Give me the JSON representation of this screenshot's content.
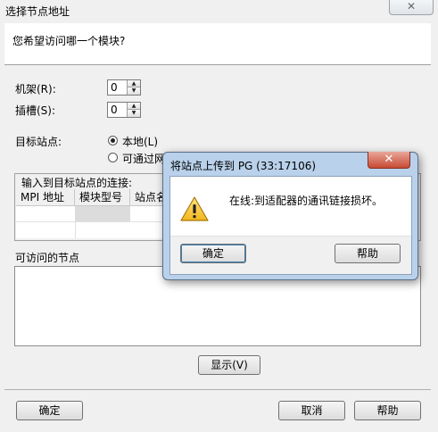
{
  "window": {
    "title": "选择节点地址",
    "close_glyph": "✕"
  },
  "header": {
    "question": "您希望访问哪一个模块?"
  },
  "rack": {
    "label": "机架(R):",
    "value": "0"
  },
  "slot": {
    "label": "插槽(S):",
    "value": "0"
  },
  "target": {
    "label": "目标站点:",
    "options": [
      "本地(L)",
      "可通过网"
    ],
    "selected": "本地(L)"
  },
  "connection": {
    "group_label": "输入到目标站点的连接:",
    "columns": [
      "MPI 地址",
      "模块型号",
      "站点名"
    ]
  },
  "accessible": {
    "label": "可访问的节点"
  },
  "buttons": {
    "show": "显示(V)",
    "ok": "确定",
    "cancel": "取消",
    "help": "帮助"
  },
  "popup": {
    "title": "将站点上传到 PG   (33:17106)",
    "close_glyph": "✕",
    "message": "在线:到适配器的通讯链接损坏。",
    "ok": "确定",
    "help": "帮助",
    "icon": "warning-icon"
  }
}
